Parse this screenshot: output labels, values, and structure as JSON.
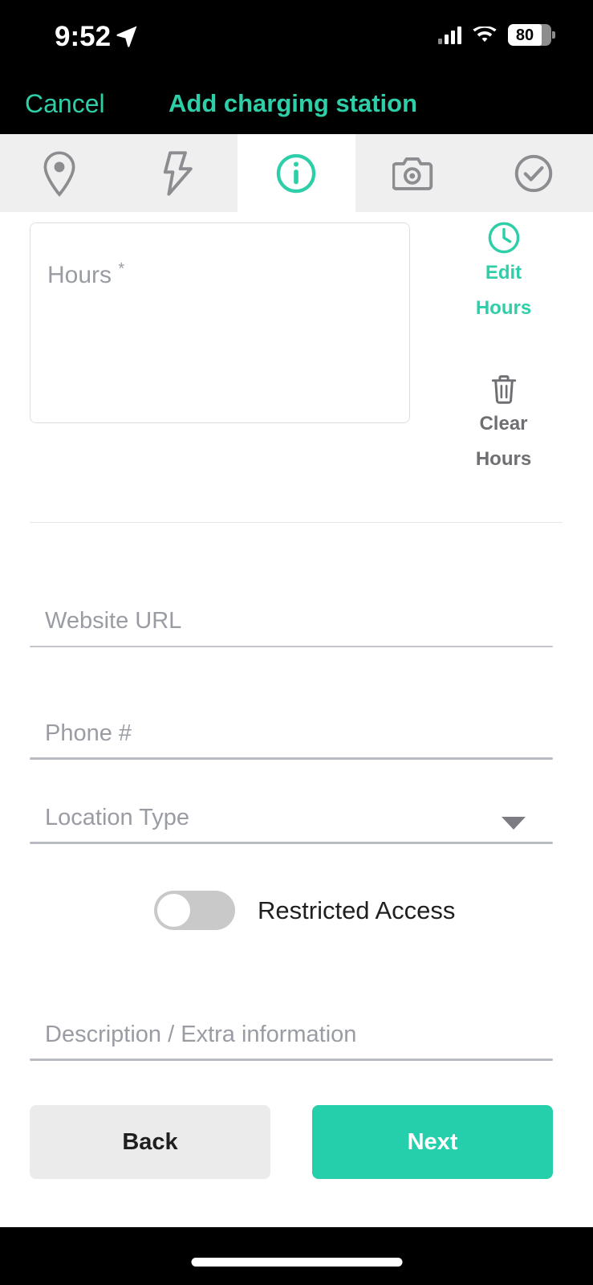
{
  "status_bar": {
    "time": "9:52",
    "location_icon": "location-arrow-icon",
    "signal_icon": "cellular-signal-icon",
    "wifi_icon": "wifi-icon",
    "battery_percent": "80"
  },
  "nav": {
    "cancel_label": "Cancel",
    "title": "Add charging station"
  },
  "tabs": [
    {
      "name": "location",
      "icon": "map-pin-icon",
      "active": false
    },
    {
      "name": "charging",
      "icon": "lightning-bolt-icon",
      "active": false
    },
    {
      "name": "info",
      "icon": "info-circle-icon",
      "active": true
    },
    {
      "name": "photos",
      "icon": "camera-icon",
      "active": false
    },
    {
      "name": "review",
      "icon": "check-circle-icon",
      "active": false
    }
  ],
  "form": {
    "hours": {
      "placeholder": "Hours",
      "required_mark": "*",
      "value": ""
    },
    "edit_hours": {
      "icon": "clock-icon",
      "line1": "Edit",
      "line2": "Hours"
    },
    "clear_hours": {
      "icon": "trash-icon",
      "line1": "Clear",
      "line2": "Hours"
    },
    "website": {
      "placeholder": "Website URL",
      "value": ""
    },
    "phone": {
      "placeholder": "Phone #",
      "value": ""
    },
    "location_type": {
      "placeholder": "Location Type",
      "value": "",
      "caret_icon": "chevron-down-icon"
    },
    "restricted_access": {
      "label": "Restricted Access",
      "enabled": false
    },
    "description": {
      "placeholder": "Description / Extra information",
      "value": ""
    }
  },
  "footer": {
    "back_label": "Back",
    "next_label": "Next"
  },
  "colors": {
    "accent_teal": "#25cfab",
    "header_bg": "#000000",
    "tabbar_bg": "#efefef",
    "placeholder_gray": "#9a9ca4",
    "back_button_bg": "#ebebeb"
  }
}
